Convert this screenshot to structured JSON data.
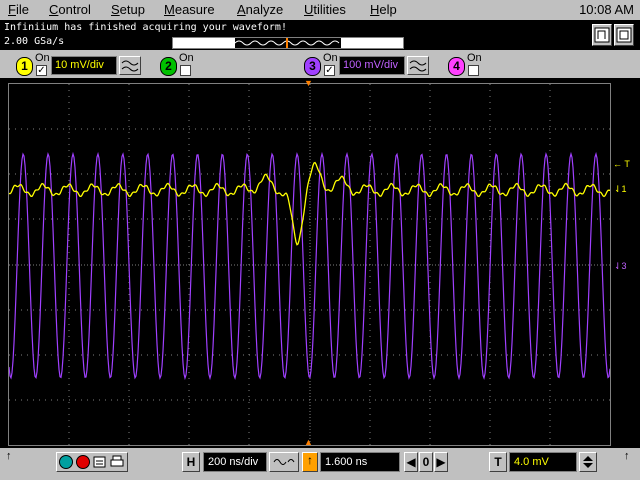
{
  "menu": {
    "items": [
      "File",
      "Control",
      "Setup",
      "Measure",
      "Analyze",
      "Utilities",
      "Help"
    ],
    "accel": [
      "F",
      "C",
      "S",
      "M",
      "A",
      "U",
      "H"
    ],
    "clock": "10:08 AM"
  },
  "status": {
    "message": "Infiniium has finished acquiring your waveform!",
    "sample_rate": "2.00 GSa/s"
  },
  "channels": [
    {
      "num": "1",
      "on_label": "On",
      "checked": true,
      "scale": "10 mV/div",
      "color": "#ffff00"
    },
    {
      "num": "2",
      "on_label": "On",
      "checked": false,
      "color": "#00ff00"
    },
    {
      "num": "3",
      "on_label": "On",
      "checked": true,
      "scale": "100 mV/div",
      "color": "#a040ff"
    },
    {
      "num": "4",
      "on_label": "On",
      "checked": false,
      "color": "#ff40ff"
    }
  ],
  "screen": {
    "markers": {
      "trigger": "T",
      "ch1": "1",
      "ch3": "3"
    },
    "trigger_level": "← T"
  },
  "bottom": {
    "horizontal_label": "H",
    "timebase": "200 ns/div",
    "delay": "1.600 ns",
    "delay_ref": "0",
    "trigger_label": "T",
    "trigger_level": "4.0 mV",
    "left_arrow": "↑",
    "right_arrow": "↑"
  },
  "colors": {
    "ch1": "#ffff00",
    "ch3": "#a040ff",
    "grid": "#808080",
    "trigger_marker": "#ff8000"
  }
}
